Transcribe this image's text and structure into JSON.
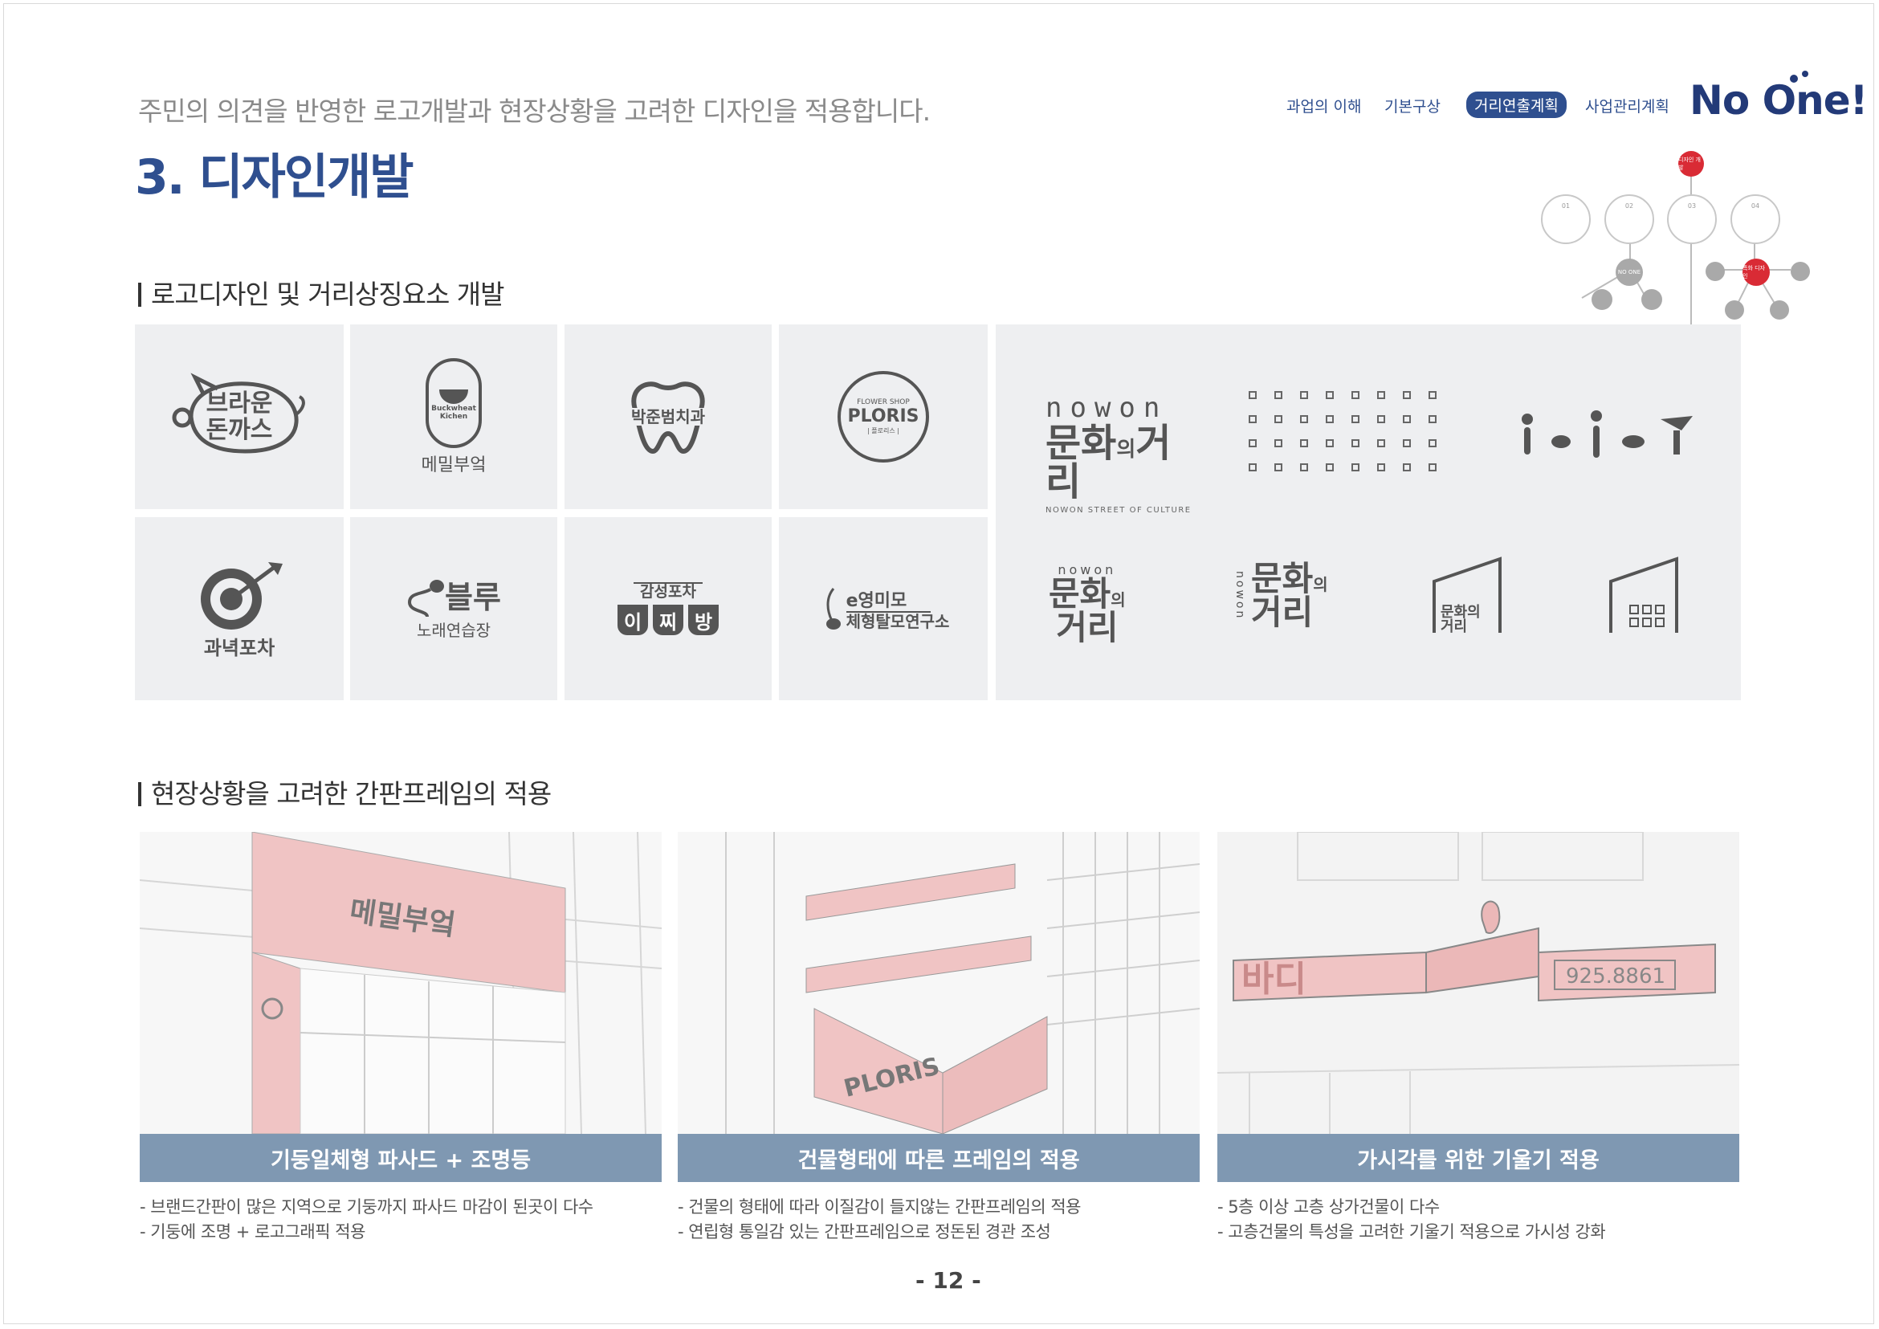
{
  "header": {
    "subtitle": "주민의 의견을 반영한 로고개발과 현장상황을 고려한 디자인을 적용합니다.",
    "title": "3. 디자인개발",
    "nav": [
      "과업의 이해",
      "기본구상",
      "거리연출계획",
      "사업관리계획"
    ],
    "nav_active_index": 2,
    "brand": "No One!"
  },
  "process_map": {
    "top_node": "디자인 개발",
    "steps": [
      "01",
      "02",
      "03",
      "04"
    ],
    "mid_node": "NO ONE",
    "red_node": "특화 디자인"
  },
  "section1": {
    "heading": "로고디자인 및 거리상징요소 개발",
    "logos": [
      {
        "id": "brown",
        "text": "브라운 돈까스"
      },
      {
        "id": "memil",
        "badge": "Buckwheat Kichen",
        "text": "메밀부엌"
      },
      {
        "id": "dental",
        "text": "박준범치과"
      },
      {
        "id": "ploris",
        "small": "FLOWER SHOP",
        "name": "PLORIS",
        "sub": "| 플로리스 |"
      },
      {
        "id": "target",
        "text": "과녁포차"
      },
      {
        "id": "blue",
        "text": "블루",
        "sub": "노래연습장"
      },
      {
        "id": "pocha",
        "top": "감성포차",
        "chars": [
          "이",
          "찌",
          "방"
        ]
      },
      {
        "id": "emimo",
        "top": "e영미모",
        "sub": "체형탈모연구소"
      }
    ],
    "street_logo": {
      "nowon": "nowon",
      "name_main": "문화",
      "name_mid": "의",
      "name_end": "거리",
      "caption": "NOWON STREET OF CULTURE"
    }
  },
  "section2": {
    "heading": "현장상황을 고려한 간판프레임의 적용",
    "cards": [
      {
        "caption": "기둥일체형 파사드 + 조명등",
        "sign": "메밀부엌",
        "lines": [
          "- 브랜드간판이 많은 지역으로 기둥까지 파사드 마감이 된곳이 다수",
          "- 기둥에 조명 + 로고그래픽 적용"
        ]
      },
      {
        "caption": "건물형태에 따른 프레임의 적용",
        "sign": "PLORIS",
        "lines": [
          "- 건물의 형태에 따라 이질감이 들지않는 간판프레임의 적용",
          "- 연립형 통일감 있는 간판프레임으로 정돈된 경관 조성"
        ]
      },
      {
        "caption": "가시각를 위한 기울기 적용",
        "sign": "925.8861",
        "lines": [
          "- 5층 이상 고층 상가건물이 다수",
          "- 고층건물의 특성을 고려한 기울기 적용으로 가시성 강화"
        ]
      }
    ]
  },
  "page_number": "- 12 -"
}
